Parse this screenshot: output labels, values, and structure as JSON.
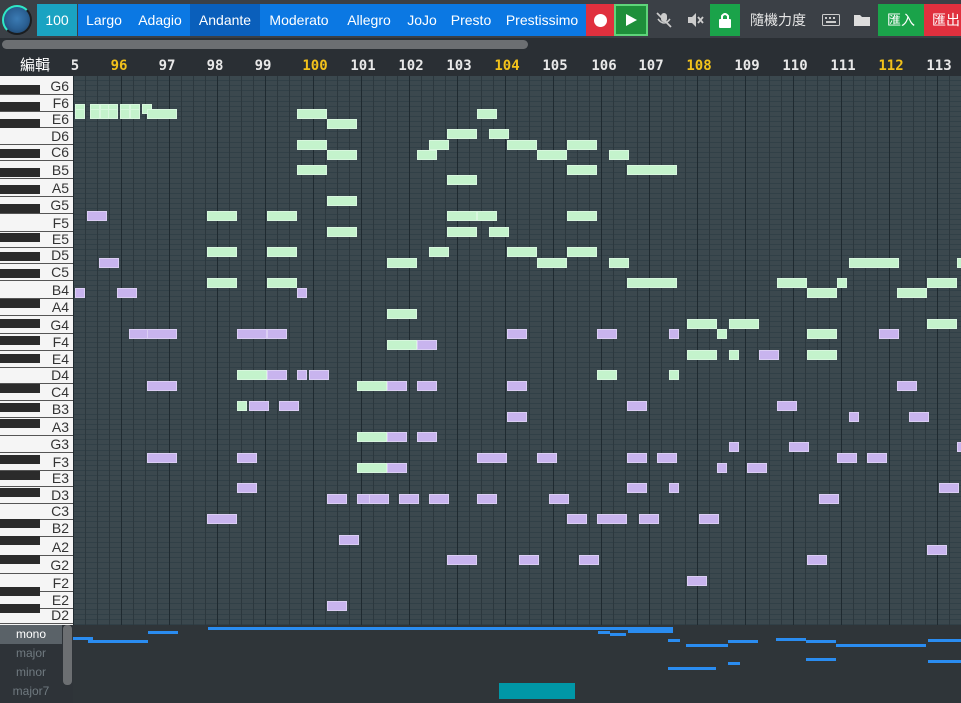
{
  "toolbar": {
    "bpm": "100",
    "tempos": [
      "Largo",
      "Adagio",
      "Andante",
      "Moderato",
      "Allegro",
      "JoJo",
      "Presto",
      "Prestissimo"
    ],
    "active_tempo": "Andante",
    "random_velocity": "隨機力度",
    "import": "匯入",
    "export": "匯出",
    "colors": {
      "record": "#e0303e",
      "play": "#1e8f3a",
      "lock": "#1aa34a",
      "import": "#1aa34a",
      "export": "#e0303e",
      "tempo": "#0b78e3"
    }
  },
  "ruler": {
    "label": "編輯",
    "measures": [
      "5",
      "96",
      "97",
      "98",
      "99",
      "100",
      "101",
      "102",
      "103",
      "104",
      "105",
      "106",
      "107",
      "108",
      "109",
      "110",
      "111",
      "112",
      "113"
    ],
    "highlighted": [
      "96",
      "100",
      "104",
      "108",
      "112"
    ]
  },
  "keys": {
    "labels": [
      "G6",
      "F6",
      "E6",
      "D6",
      "C6",
      "B5",
      "A5",
      "G5",
      "F5",
      "E5",
      "D5",
      "C5",
      "B4",
      "A4",
      "G4",
      "F4",
      "E4",
      "D4",
      "C4",
      "B3",
      "A3",
      "G3",
      "F3",
      "E3",
      "D3",
      "C3",
      "B2",
      "A2",
      "G2",
      "F2",
      "E2",
      "D2"
    ]
  },
  "sidebar": {
    "scales": [
      "mono",
      "major",
      "minor",
      "major7"
    ],
    "selected": "mono"
  },
  "notes": {
    "green": [
      [
        75,
        5,
        1
      ],
      [
        75,
        6,
        1
      ],
      [
        100,
        5,
        1
      ],
      [
        100,
        6,
        1
      ],
      [
        90,
        5,
        1
      ],
      [
        90,
        6,
        1
      ],
      [
        108,
        5,
        1
      ],
      [
        108,
        6,
        1
      ],
      [
        120,
        5,
        1
      ],
      [
        120,
        6,
        1
      ],
      [
        130,
        5,
        1
      ],
      [
        130,
        6,
        1
      ],
      [
        142,
        5,
        1
      ],
      [
        147,
        6,
        3
      ],
      [
        297,
        6,
        3
      ],
      [
        327,
        8,
        3
      ],
      [
        447,
        10,
        3
      ],
      [
        477,
        6,
        2
      ],
      [
        489,
        10,
        2
      ],
      [
        297,
        12,
        3
      ],
      [
        327,
        14,
        3
      ],
      [
        429,
        12,
        2
      ],
      [
        417,
        14,
        2
      ],
      [
        507,
        12,
        3
      ],
      [
        537,
        14,
        3
      ],
      [
        567,
        12,
        3
      ],
      [
        609,
        14,
        2
      ],
      [
        297,
        17,
        3
      ],
      [
        447,
        19,
        3
      ],
      [
        567,
        17,
        3
      ],
      [
        627,
        17,
        5
      ],
      [
        327,
        23,
        3
      ],
      [
        207,
        26,
        3
      ],
      [
        267,
        26,
        3
      ],
      [
        327,
        29,
        3
      ],
      [
        447,
        26,
        3
      ],
      [
        477,
        26,
        2
      ],
      [
        567,
        26,
        3
      ],
      [
        447,
        29,
        3
      ],
      [
        489,
        29,
        2
      ],
      [
        207,
        33,
        3
      ],
      [
        267,
        33,
        3
      ],
      [
        387,
        35,
        3
      ],
      [
        429,
        33,
        2
      ],
      [
        507,
        33,
        3
      ],
      [
        537,
        35,
        3
      ],
      [
        567,
        33,
        3
      ],
      [
        609,
        35,
        2
      ],
      [
        849,
        35,
        5
      ],
      [
        957,
        35,
        1
      ],
      [
        207,
        39,
        3
      ],
      [
        267,
        39,
        3
      ],
      [
        627,
        39,
        5
      ],
      [
        777,
        39,
        3
      ],
      [
        807,
        41,
        3
      ],
      [
        837,
        39,
        1
      ],
      [
        897,
        41,
        3
      ],
      [
        927,
        39,
        3
      ],
      [
        387,
        45,
        3
      ],
      [
        687,
        47,
        3
      ],
      [
        717,
        49,
        1
      ],
      [
        729,
        47,
        3
      ],
      [
        807,
        49,
        3
      ],
      [
        927,
        47,
        3
      ],
      [
        387,
        51,
        3
      ],
      [
        687,
        53,
        3
      ],
      [
        729,
        53,
        1
      ],
      [
        807,
        53,
        3
      ],
      [
        237,
        57,
        3
      ],
      [
        597,
        57,
        2
      ],
      [
        669,
        57,
        1
      ],
      [
        357,
        59,
        3
      ],
      [
        237,
        63,
        1
      ],
      [
        357,
        69,
        3
      ],
      [
        357,
        75,
        3
      ]
    ],
    "purple": [
      [
        87,
        26,
        2
      ],
      [
        99,
        35,
        2
      ],
      [
        75,
        41,
        1
      ],
      [
        117,
        41,
        2
      ],
      [
        129,
        49,
        2
      ],
      [
        147,
        49,
        3
      ],
      [
        237,
        49,
        3
      ],
      [
        267,
        49,
        2
      ],
      [
        297,
        41,
        1
      ],
      [
        417,
        51,
        2
      ],
      [
        507,
        49,
        2
      ],
      [
        597,
        49,
        2
      ],
      [
        669,
        49,
        1
      ],
      [
        759,
        53,
        2
      ],
      [
        879,
        49,
        2
      ],
      [
        267,
        57,
        2
      ],
      [
        297,
        57,
        1
      ],
      [
        309,
        57,
        2
      ],
      [
        387,
        59,
        2
      ],
      [
        417,
        59,
        2
      ],
      [
        507,
        59,
        2
      ],
      [
        897,
        59,
        2
      ],
      [
        147,
        59,
        3
      ],
      [
        249,
        63,
        2
      ],
      [
        279,
        63,
        2
      ],
      [
        507,
        65,
        2
      ],
      [
        627,
        63,
        2
      ],
      [
        777,
        63,
        2
      ],
      [
        849,
        65,
        1
      ],
      [
        909,
        65,
        2
      ],
      [
        387,
        69,
        2
      ],
      [
        417,
        69,
        2
      ],
      [
        729,
        71,
        1
      ],
      [
        789,
        71,
        2
      ],
      [
        957,
        71,
        1
      ],
      [
        147,
        73,
        3
      ],
      [
        237,
        73,
        2
      ],
      [
        477,
        73,
        3
      ],
      [
        537,
        73,
        2
      ],
      [
        627,
        73,
        2
      ],
      [
        657,
        73,
        2
      ],
      [
        837,
        73,
        2
      ],
      [
        867,
        73,
        2
      ],
      [
        717,
        75,
        1
      ],
      [
        747,
        75,
        2
      ],
      [
        387,
        75,
        2
      ],
      [
        237,
        79,
        2
      ],
      [
        327,
        81,
        2
      ],
      [
        357,
        81,
        2
      ],
      [
        369,
        81,
        2
      ],
      [
        399,
        81,
        2
      ],
      [
        429,
        81,
        2
      ],
      [
        477,
        81,
        2
      ],
      [
        549,
        81,
        2
      ],
      [
        627,
        79,
        2
      ],
      [
        669,
        79,
        1
      ],
      [
        819,
        81,
        2
      ],
      [
        939,
        79,
        2
      ],
      [
        207,
        85,
        3
      ],
      [
        567,
        85,
        2
      ],
      [
        597,
        85,
        3
      ],
      [
        639,
        85,
        2
      ],
      [
        699,
        85,
        2
      ],
      [
        339,
        89,
        2
      ],
      [
        447,
        93,
        3
      ],
      [
        519,
        93,
        2
      ],
      [
        579,
        93,
        2
      ],
      [
        807,
        93,
        2
      ],
      [
        927,
        91,
        2
      ],
      [
        687,
        97,
        2
      ],
      [
        327,
        102,
        2
      ]
    ]
  }
}
